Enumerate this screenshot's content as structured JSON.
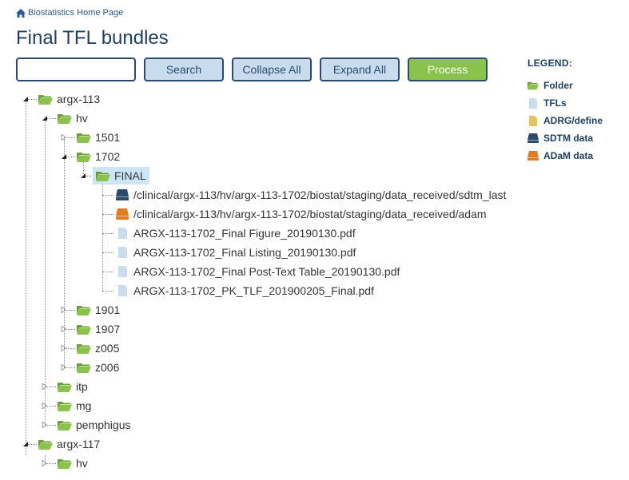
{
  "breadcrumb": {
    "label": "Biostatistics Home Page"
  },
  "page": {
    "title": "Final TFL bundles"
  },
  "toolbar": {
    "search_value": "",
    "search_label": "Search",
    "collapse_label": "Collapse All",
    "expand_label": "Expand All",
    "process_label": "Process"
  },
  "legend": {
    "title": "LEGEND:",
    "items": [
      {
        "label": "Folder",
        "icon": "folder-icon"
      },
      {
        "label": "TFLs",
        "icon": "file-icon"
      },
      {
        "label": "ADRG/define",
        "icon": "file-icon"
      },
      {
        "label": "SDTM data",
        "icon": "database-icon"
      },
      {
        "label": "ADaM data",
        "icon": "database-icon"
      }
    ]
  },
  "colors": {
    "folder": "#8bc34a",
    "tfl": "#c9dced",
    "adrg": "#e8c25a",
    "sdtm": "#2c4a6b",
    "adam": "#e07b1f",
    "selected": "#cde6f7",
    "heading": "#1f3f63"
  },
  "tree": {
    "nodes": [
      {
        "label": "argx-113",
        "type": "folder"
      },
      {
        "label": "hv",
        "type": "folder"
      },
      {
        "label": "1501",
        "type": "folder"
      },
      {
        "label": "1702",
        "type": "folder"
      },
      {
        "label": "FINAL",
        "type": "folder",
        "selected": true
      },
      {
        "label": "/clinical/argx-113/hv/argx-113-1702/biostat/staging/data_received/sdtm_last",
        "type": "sdtm"
      },
      {
        "label": "/clinical/argx-113/hv/argx-113-1702/biostat/staging/data_received/adam",
        "type": "adam"
      },
      {
        "label": "ARGX-113-1702_Final Figure_20190130.pdf",
        "type": "tfl"
      },
      {
        "label": "ARGX-113-1702_Final Listing_20190130.pdf",
        "type": "tfl"
      },
      {
        "label": "ARGX-113-1702_Final Post-Text Table_20190130.pdf",
        "type": "tfl"
      },
      {
        "label": "ARGX-113-1702_PK_TLF_201900205_Final.pdf",
        "type": "tfl"
      },
      {
        "label": "1901",
        "type": "folder"
      },
      {
        "label": "1907",
        "type": "folder"
      },
      {
        "label": "z005",
        "type": "folder"
      },
      {
        "label": "z006",
        "type": "folder"
      },
      {
        "label": "itp",
        "type": "folder"
      },
      {
        "label": "mg",
        "type": "folder"
      },
      {
        "label": "pemphigus",
        "type": "folder"
      },
      {
        "label": "argx-117",
        "type": "folder"
      },
      {
        "label": "hv",
        "type": "folder"
      }
    ]
  }
}
